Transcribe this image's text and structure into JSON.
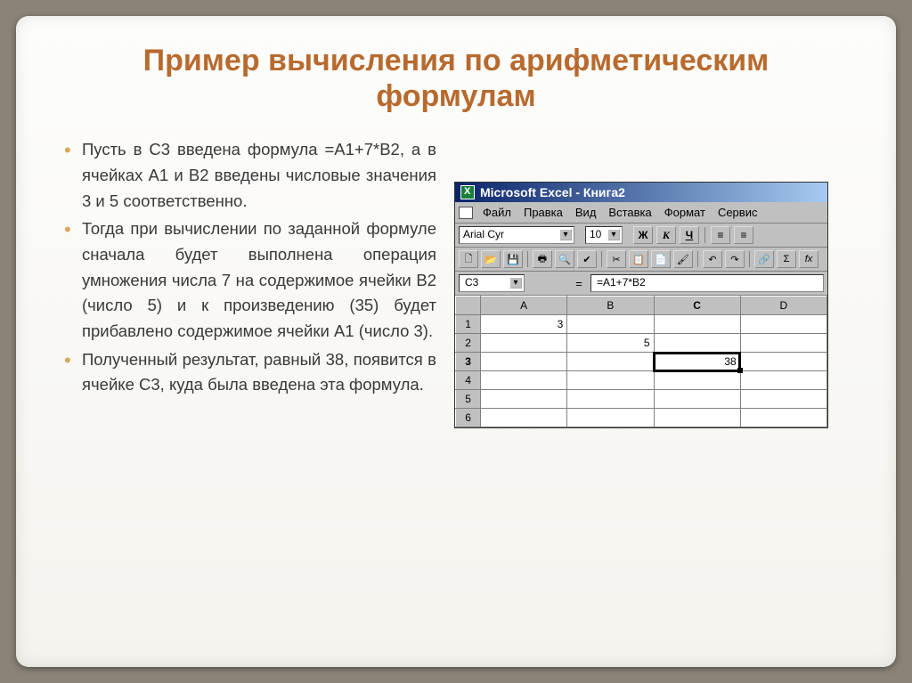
{
  "slide": {
    "title": "Пример вычисления по арифметическим формулам",
    "bullets": [
      "Пусть в C3 введена формула =A1+7*B2, а в ячейках A1 и B2 введены числовые значения 3 и 5 соответственно.",
      "Тогда при вычислении по заданной формуле сначала будет выполнена операция умножения числа 7 на содержимое ячейки B2 (число 5) и к произведению (35) будет прибавлено содержимое ячейки A1 (число 3).",
      "Полученный результат, равный 38, появится в ячейке C3, куда была введена эта формула."
    ]
  },
  "excel": {
    "title": "Microsoft Excel - Книга2",
    "menu": [
      "Файл",
      "Правка",
      "Вид",
      "Вставка",
      "Формат",
      "Сервис"
    ],
    "font": "Arial Cyr",
    "fontsize": "10",
    "buttons": {
      "bold": "Ж",
      "italic": "К",
      "underline": "Ч"
    },
    "cellname": "C3",
    "formula": "=A1+7*B2",
    "cols": [
      "A",
      "B",
      "C",
      "D"
    ],
    "rows": [
      "1",
      "2",
      "3",
      "4",
      "5",
      "6"
    ],
    "cells": {
      "A1": "3",
      "B2": "5",
      "C3": "38"
    }
  }
}
